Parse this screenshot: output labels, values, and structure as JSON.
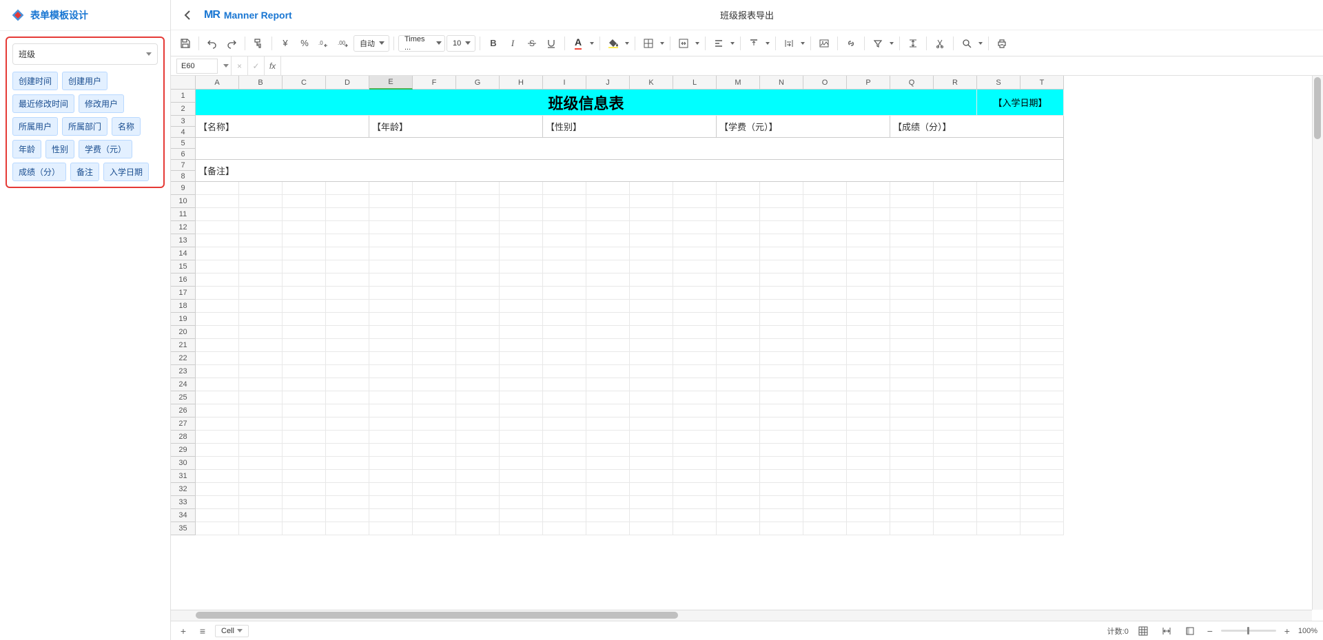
{
  "sidebar": {
    "title": "表单模板设计",
    "select_label": "班级",
    "fields": [
      "创建时间",
      "创建用户",
      "最近修改时间",
      "修改用户",
      "所属用户",
      "所属部门",
      "名称",
      "年龄",
      "性别",
      "学费（元）",
      "成绩（分）",
      "备注",
      "入学日期"
    ]
  },
  "header": {
    "brand_logo": "MR",
    "brand_text": "Manner Report",
    "doc_title": "班级报表导出"
  },
  "toolbar": {
    "auto_label": "自动",
    "font_label": "Times ...",
    "font_size": "10"
  },
  "formula_bar": {
    "cell_name": "E60",
    "fx_label": "fx"
  },
  "grid": {
    "columns": [
      "A",
      "B",
      "C",
      "D",
      "E",
      "F",
      "G",
      "H",
      "I",
      "J",
      "K",
      "L",
      "M",
      "N",
      "O",
      "P",
      "Q",
      "R",
      "S",
      "T"
    ],
    "selected_col": "E",
    "row_count": 35,
    "title_text": "班级信息表",
    "date_label": "【入学日期】",
    "headers3": {
      "0": "【名称】",
      "4": "【年龄】",
      "8": "【性别】",
      "12": "【学费（元）】",
      "16": "【成绩（分）】"
    },
    "row7": {
      "0": "【备注】"
    }
  },
  "bottom": {
    "sheet_tab": "Cell",
    "count_label": "计数:0",
    "zoom_pct": "100%"
  }
}
